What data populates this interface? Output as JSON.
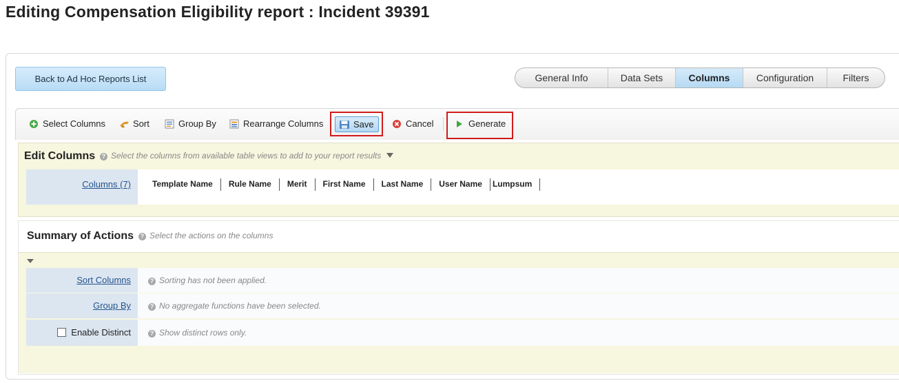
{
  "page": {
    "title": "Editing Compensation Eligibility report : Incident 39391"
  },
  "back_button": {
    "label": "Back to Ad Hoc Reports List"
  },
  "tabs": [
    {
      "label": "General Info",
      "active": false
    },
    {
      "label": "Data Sets",
      "active": false
    },
    {
      "label": "Columns",
      "active": true
    },
    {
      "label": "Configuration",
      "active": false
    },
    {
      "label": "Filters",
      "active": false
    }
  ],
  "toolbar": {
    "select_columns": "Select Columns",
    "sort": "Sort",
    "group_by": "Group By",
    "rearrange_columns": "Rearrange Columns",
    "save": "Save",
    "cancel": "Cancel",
    "generate": "Generate"
  },
  "edit_columns": {
    "title": "Edit Columns",
    "hint": "Select the columns from available table views to add to your report results",
    "columns_label": "Columns (7)",
    "columns": [
      "Template Name",
      "Rule Name",
      "Merit",
      "First Name",
      "Last Name",
      "User Name",
      "Lumpsum"
    ]
  },
  "summary": {
    "title": "Summary of Actions",
    "hint": "Select the actions on the columns",
    "rows": [
      {
        "label": "Sort Columns",
        "value": "Sorting has not been applied."
      },
      {
        "label": "Group By",
        "value": "No aggregate functions have been selected."
      },
      {
        "label": "Enable Distinct",
        "value": "Show distinct rows only."
      }
    ]
  },
  "colors": {
    "tab_active": "#b5d9f3",
    "highlight_box": "#d11a1a",
    "section_bg": "#f7f6df",
    "label_bg": "#dce6f1"
  }
}
